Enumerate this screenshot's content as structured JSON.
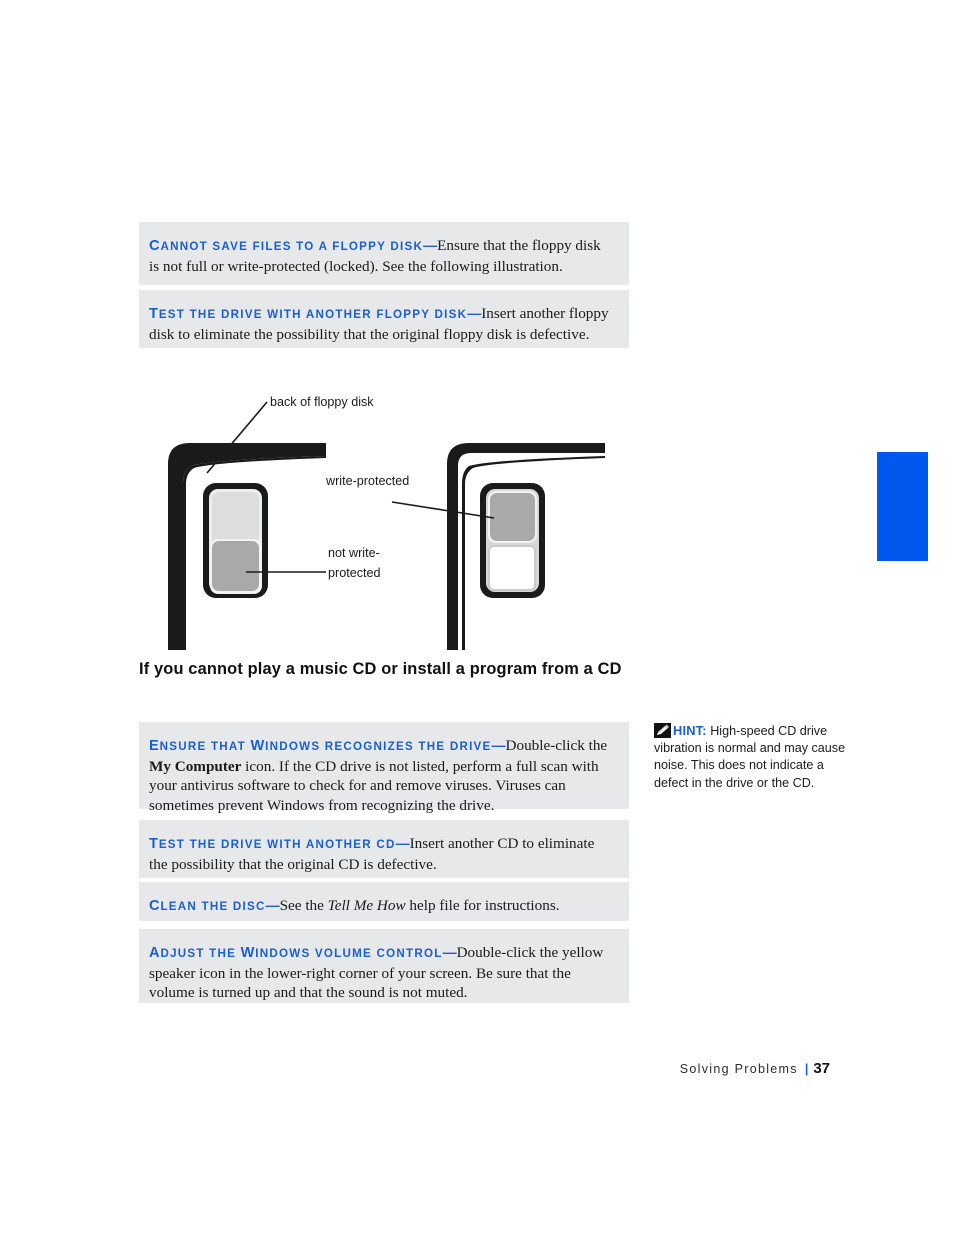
{
  "page": {
    "footer_section": "Solving Problems",
    "footer_separator": "|",
    "page_number": "37"
  },
  "floppy_section": {
    "boxes": [
      {
        "lead_initial": "C",
        "lead_rest": "ANNOT SAVE FILES TO A FLOPPY DISK",
        "dash": "—",
        "body": "Ensure that the floppy disk is not full or write-protected (locked). See the following illustration."
      },
      {
        "lead_initial": "T",
        "lead_rest": "EST THE DRIVE WITH ANOTHER FLOPPY DISK",
        "dash": "—",
        "body": "Insert another floppy disk to eliminate the possibility that the original floppy disk is defective."
      }
    ]
  },
  "figure": {
    "alt": "Back of two floppy disks showing write-protect tab positions",
    "labels": {
      "back_of_disk": "back of floppy disk",
      "write_protected": "write-protected",
      "not_write_protected_line1": "not write-",
      "not_write_protected_line2": "protected"
    }
  },
  "cd_section": {
    "heading": "If you cannot play a music CD or install a program from a CD",
    "boxes": [
      {
        "lead_initial": "E",
        "lead_rest_a": "NSURE THAT ",
        "lead_cap_w": "W",
        "lead_rest_b": "INDOWS RECOGNIZES THE DRIVE",
        "dash": "—",
        "body_part1": "Double-click the ",
        "body_bold": "My Computer",
        "body_part2": " icon. If the CD drive is not listed, perform a full scan with your antivirus software to check for and remove viruses. Viruses can sometimes prevent Windows from recognizing the drive."
      },
      {
        "lead_initial": "T",
        "lead_rest": "EST THE DRIVE WITH ANOTHER CD",
        "dash": "—",
        "body": "Insert another CD to eliminate the possibility that the original CD is defective."
      },
      {
        "lead_initial": "C",
        "lead_rest": "LEAN THE DISC",
        "dash": "—",
        "body_part1": "See the ",
        "body_italic": "Tell Me How",
        "body_part2": " help file for instructions."
      },
      {
        "lead_initial": "A",
        "lead_rest_a": "DJUST THE ",
        "lead_cap_w": "W",
        "lead_rest_b": "INDOWS VOLUME CONTROL",
        "dash": "—",
        "body": "Double-click the yellow speaker icon in the lower-right corner of your screen. Be sure that the volume is turned up and that the sound is not muted."
      }
    ]
  },
  "hint": {
    "icon": "pencil-note-icon",
    "label": "HINT:",
    "text": " High-speed CD drive vibration is normal and may cause noise. This does not indicate a defect in the drive or the CD."
  },
  "colors": {
    "lead_blue": "#1a5fd0",
    "box_gray": "#e7e8ea",
    "tab_blue": "#0057ee",
    "body_text": "#1b1b1b"
  }
}
